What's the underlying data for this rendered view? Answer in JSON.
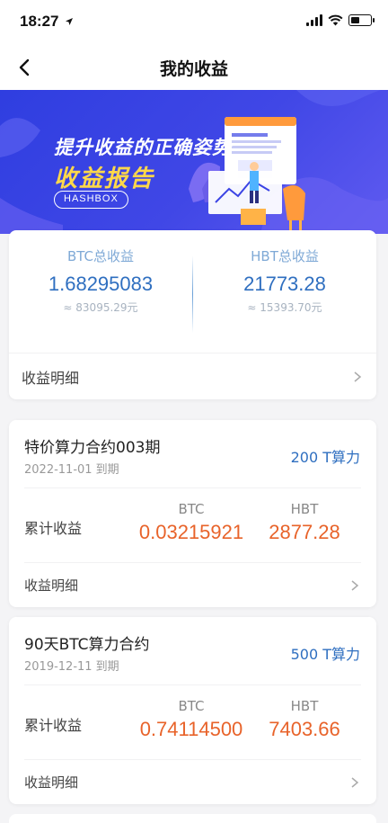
{
  "status_bar": {
    "time": "18:27"
  },
  "nav": {
    "title": "我的收益"
  },
  "banner": {
    "line1": "提升收益的正确姿势",
    "line2": "收益报告",
    "brand": "HASHBOX"
  },
  "summary": {
    "btc": {
      "label": "BTC总收益",
      "value": "1.68295083",
      "cny": "≈ 83095.29元"
    },
    "hbt": {
      "label": "HBT总收益",
      "value": "21773.28",
      "cny": "≈ 15393.70元"
    },
    "detail_label": "收益明细"
  },
  "contracts": [
    {
      "name": "特价算力合约003期",
      "expire": "2022-11-01 到期",
      "power": "200 T算力",
      "acc_label": "累计收益",
      "btc_label": "BTC",
      "btc_value": "0.03215921",
      "hbt_label": "HBT",
      "hbt_value": "2877.28",
      "detail_label": "收益明细"
    },
    {
      "name": "90天BTC算力合约",
      "expire": "2019-12-11 到期",
      "power": "500 T算力",
      "acc_label": "累计收益",
      "btc_label": "BTC",
      "btc_value": "0.74114500",
      "hbt_label": "HBT",
      "hbt_value": "7403.66",
      "detail_label": "收益明细"
    }
  ],
  "icons": {
    "back": "chevron-left-icon",
    "row_arrow": "chevron-right-icon",
    "signal": "signal-icon",
    "wifi": "wifi-icon",
    "battery": "battery-icon",
    "location": "location-arrow-icon"
  },
  "colors": {
    "banner": "#3b44e4",
    "accent_blue": "#2f6fc0",
    "accent_orange": "#e8632a",
    "banner_yellow": "#ffd84a"
  }
}
